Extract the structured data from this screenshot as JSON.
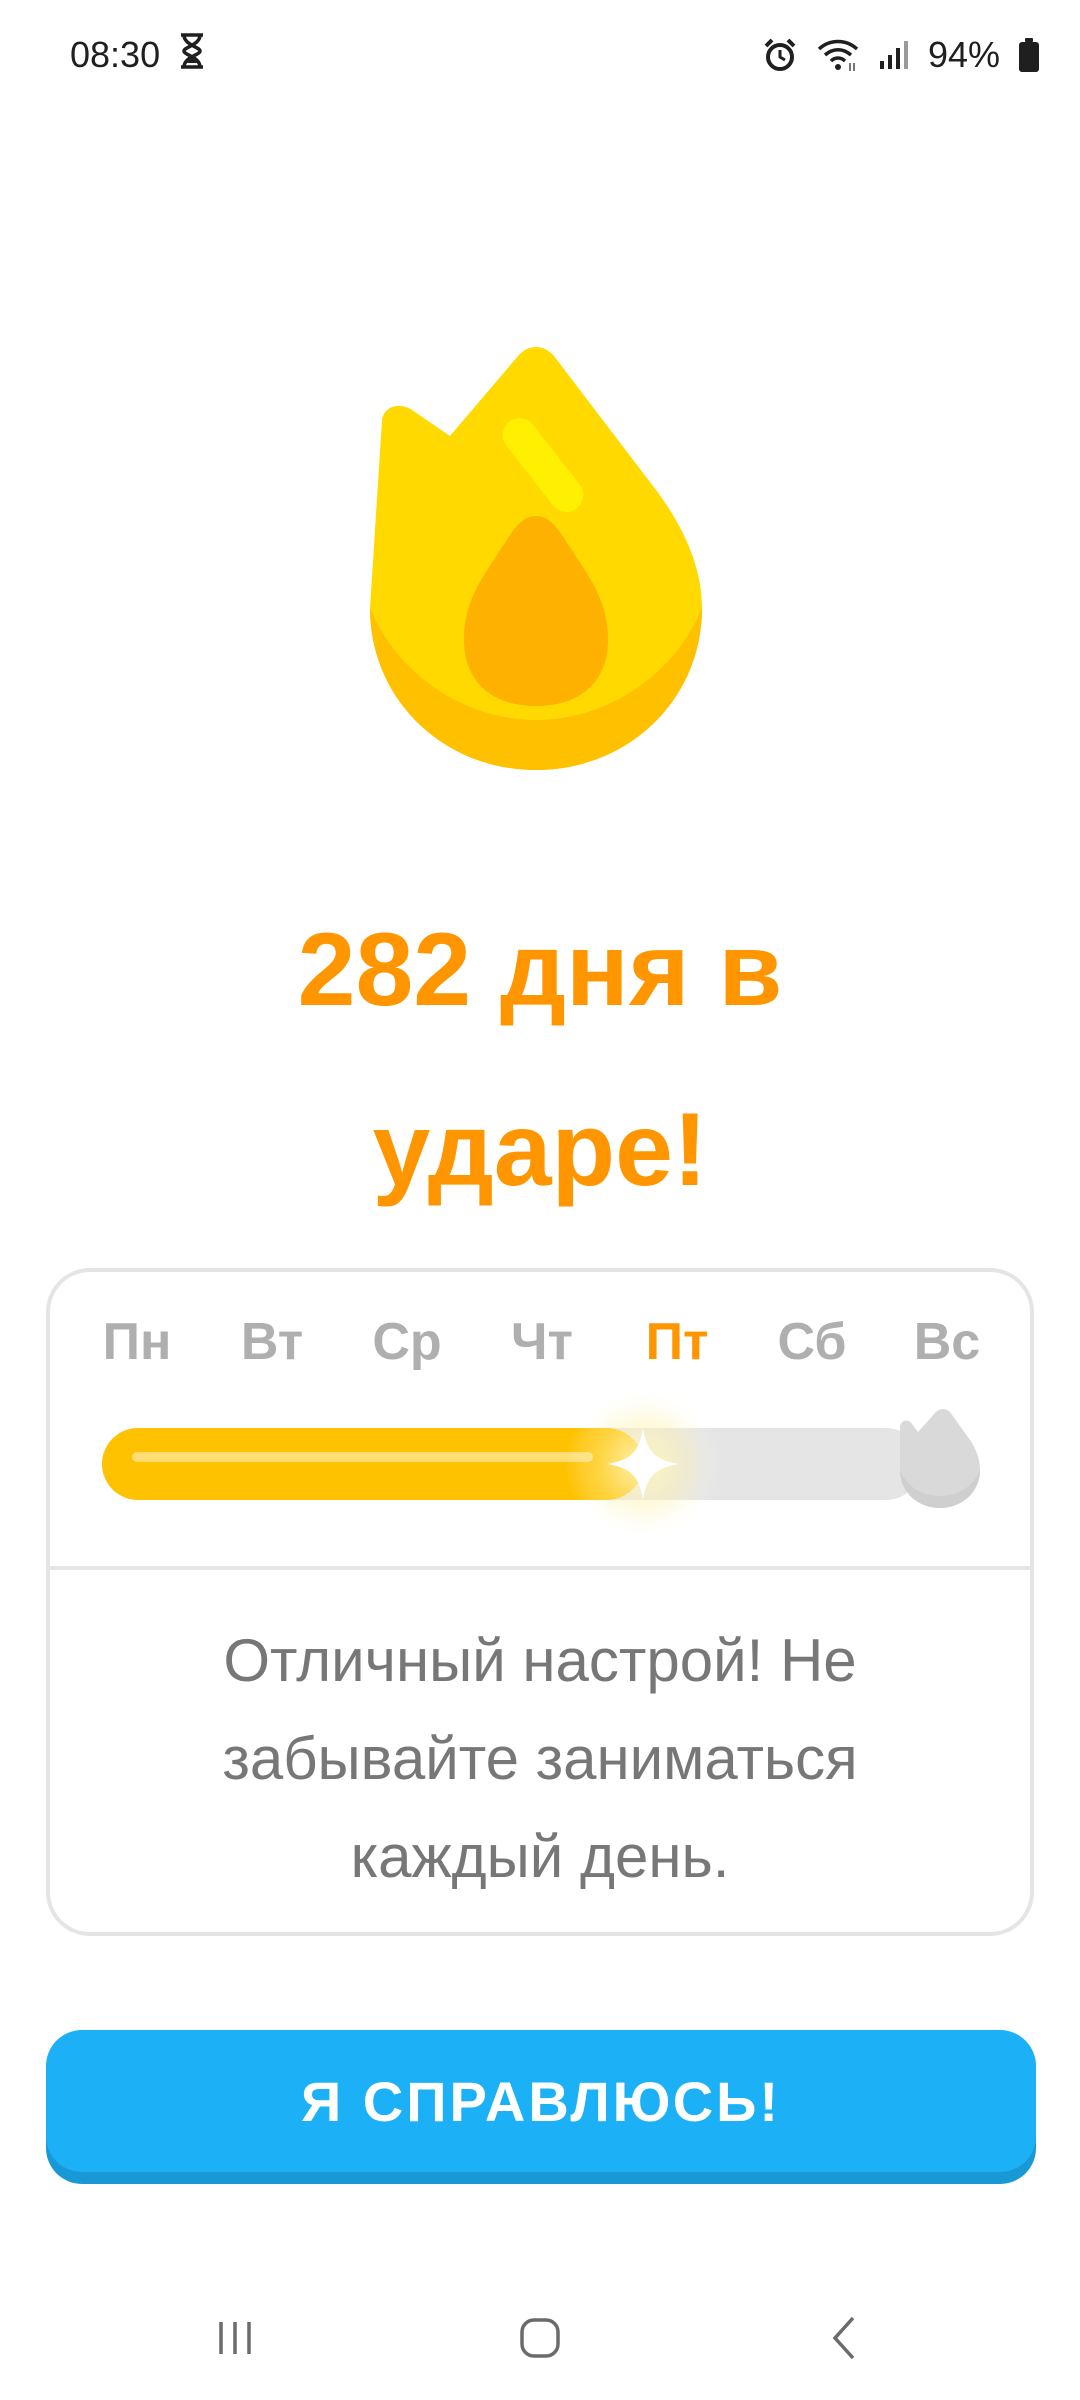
{
  "status_bar": {
    "time": "08:30",
    "battery": "94%"
  },
  "streak": {
    "title": "282 дня в ударе!",
    "days": [
      "Пн",
      "Вт",
      "Ср",
      "Чт",
      "Пт",
      "Сб",
      "Вс"
    ],
    "active_day_index": 4,
    "progress_fraction": 0.66,
    "message": "Отличный настрой! Не забывайте заниматься каждый день."
  },
  "button": {
    "label": "Я СПРАВЛЮСЬ!"
  },
  "colors": {
    "accent_orange": "#ff9600",
    "flame_yellow": "#ffd900",
    "flame_inner": "#ffb100",
    "button_blue": "#1cb0f6"
  },
  "icons": {
    "status": [
      "hourglass-icon",
      "alarm-icon",
      "wifi-icon",
      "signal-icon",
      "battery-icon"
    ],
    "nav": [
      "recents-icon",
      "home-icon",
      "back-icon"
    ]
  }
}
